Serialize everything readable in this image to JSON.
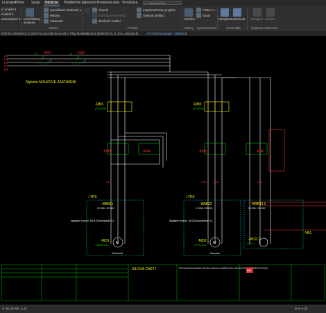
{
  "menu_tabs": [
    {
      "label": "ní projekt"
    },
    {
      "label": "Přidej"
    },
    {
      "label": "Spoje"
    },
    {
      "label": "Nástroje"
    },
    {
      "label": "Předběžné plánování"
    },
    {
      "label": "Kmenová data"
    },
    {
      "label": "Vizalizáce"
    }
  ],
  "search": {
    "placeholder": "Hledat příkaz"
  },
  "ribbon": {
    "items": {
      "a": "ní projekt ▾",
      "b": "modelů ▾",
      "c": "automatizaci ▾",
      "identify": "Identifikátory struktury",
      "vlastnost": "Uspořádání vlastností ▾",
      "hladiny": "Hladiny",
      "vlastnosti": "Vlastnosti",
      "slovnik": "Slovník",
      "sub1": "Substituce materiálu",
      "sub2": "Zkušební zadání",
      "imp1": "Importovat texty projektu",
      "imp2": "Odebrat překlad",
      "vymena": "Výměna",
      "funkce": "Funkce ▾",
      "spoje": "Spoje",
      "navigator": "Navigátor",
      "importovat": "Importovat",
      "designer": "Designer",
      "builder": "Builder"
    },
    "groups": {
      "sprava": "Správa",
      "preklad": "Překlad",
      "normy": "Normy",
      "sync": "Synchronizace",
      "komentare": "Komentáře",
      "cogineer": "Cogineer Advanced"
    }
  },
  "pathbar": {
    "left": "\\Fx2 for SINAMICS S120\\v Fx2con-sole.fx-sy.edb > Plug M2\\MultiLine/1 (SIMOTICS_S_Fx2_20211218)",
    "tab": "=F1+X1/3 (Karusel + chlazení)"
  },
  "drawing": {
    "contactor_left": "-KM1",
    "contactor_left2": "-KM2",
    "contactor_note": "Stykače NOUZOVÉ ZASTAVENÍ",
    "qm1": "-QM1",
    "qm1_sub": "(3x2000A)",
    "qm2": "-QM2",
    "qm2_sub": "(3x2000A)",
    "km3": "-KM3",
    "km4": "-KM4",
    "km5": "-KM5",
    "km6": "-KM6",
    "km7": "-KM7",
    "xl2_1": "-XL2",
    "xl2_2": "-XL2",
    "xl2_3": "-XL2",
    "xl2_4": "-XL2",
    "tps1": "+TPS",
    "tps2": "+TPS",
    "wmo1": "-WMO1",
    "wmo1_spec": "12 000 / 32 000",
    "wmo2": "-WMO2",
    "wmo2_spec": "12 000 / 32 000",
    "wmo21": "-WMO2.1",
    "wmo21_spec": "12 000 / 32 000",
    "mo1": "-MO1",
    "mo1_spec": "1380W 3,3A",
    "mo1_name": "Zdvihově",
    "mo2": "-MO2",
    "mo2_spec": "370W 3,3A",
    "mo2_name": "Karusel",
    "mo21": "-MO2.1",
    "mo21_spec": "MCL1 F",
    "yb1": "-YB1",
    "napajeni": "Napájení motoru -MO1(Zdroj/výstráž X1-",
    "napajeni2": "Napájení motoru -MO2(Zdroj/výstráž X1-",
    "titlebar_name": "SILOVÁ ČÁST I",
    "titlebar_desc": "Tento dokument obsahuje informace, které jsou majetkem firmy. Jeho kopírování, předávání třetí straně",
    "logo": "ed",
    "l_labels": [
      "L1",
      "L2",
      "L3",
      "N",
      "PE"
    ]
  },
  "status": {
    "coords": "X: 91,23 RX: 4,42"
  },
  "colors": {
    "accent": "#4a90d9",
    "wire": "#ffffff",
    "device": "#00c000",
    "fuse": "#ffff00",
    "label_red": "#ff3030",
    "cable": "#00b0b0"
  }
}
